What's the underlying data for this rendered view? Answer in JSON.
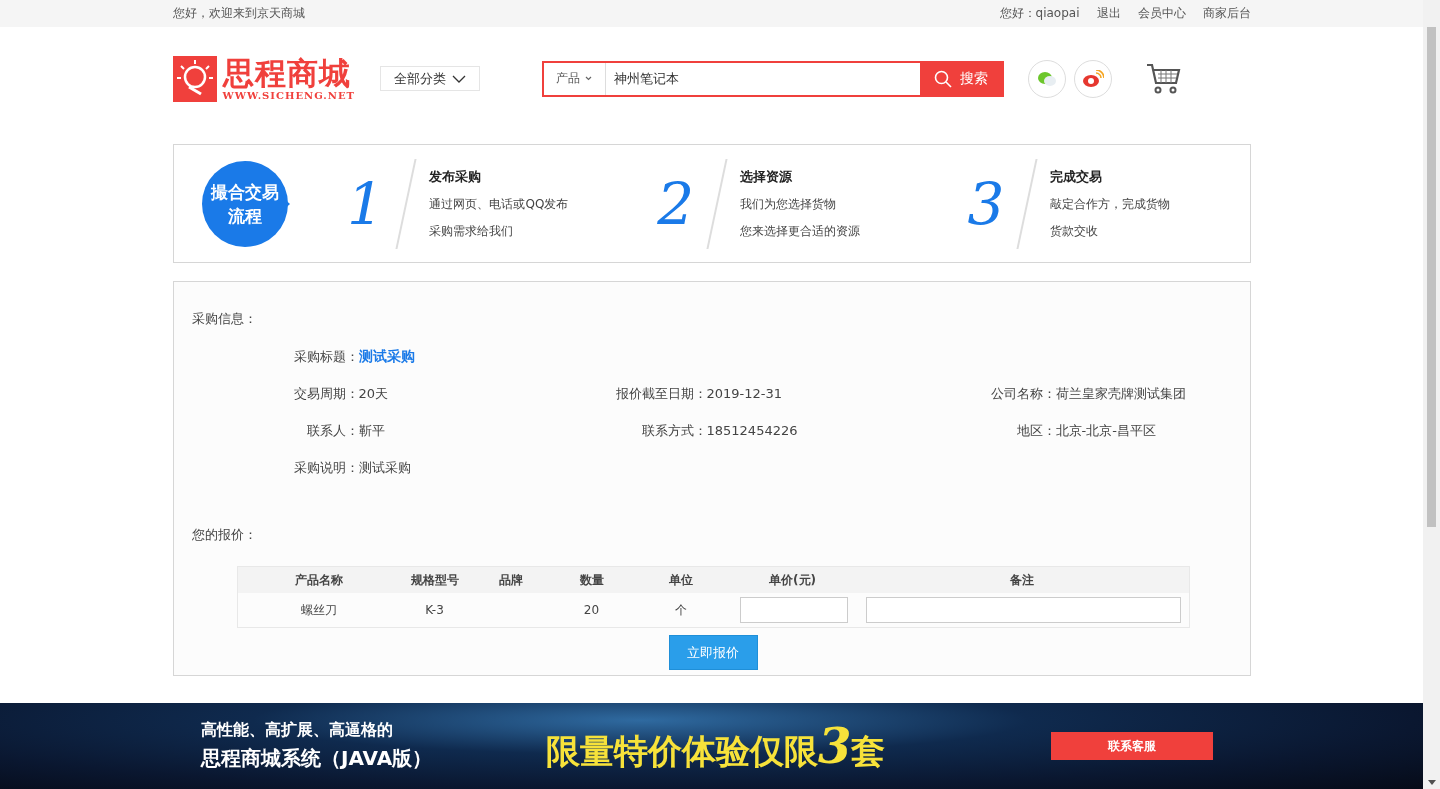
{
  "top_bar": {
    "welcome": "您好，欢迎来到京天商城",
    "user": "您好：qiaopai",
    "links": [
      "退出",
      "会员中心",
      "商家后台"
    ]
  },
  "header": {
    "logo": {
      "name": "思程商城",
      "url": "WWW.SICHENG.NET"
    },
    "category_button": "全部分类",
    "search": {
      "scope": "产品",
      "value": "神州笔记本",
      "button": "搜索"
    }
  },
  "process": {
    "badge": [
      "撮合交易",
      "流程"
    ],
    "steps": [
      {
        "number": "1",
        "title": "发布采购",
        "lines": [
          "通过网页、电话或QQ发布",
          "采购需求给我们"
        ]
      },
      {
        "number": "2",
        "title": "选择资源",
        "lines": [
          "我们为您选择货物",
          "您来选择更合适的资源"
        ]
      },
      {
        "number": "3",
        "title": "完成交易",
        "lines": [
          "敲定合作方，完成货物",
          "货款交收"
        ]
      }
    ]
  },
  "purchase": {
    "heading": "采购信息：",
    "rows": [
      [
        {
          "label": "采购标题：",
          "value": "测试采购",
          "kind": "link"
        }
      ],
      [
        {
          "label": "交易周期：",
          "value": "20天",
          "kind": "text"
        },
        {
          "label": "报价截至日期：",
          "value": "2019-12-31",
          "kind": "text"
        },
        {
          "label": "公司名称：",
          "value": "荷兰皇家壳牌测试集团",
          "kind": "text"
        }
      ],
      [
        {
          "label": "联系人：",
          "value": "靳平",
          "kind": "text"
        },
        {
          "label": "联系方式：",
          "value": "18512454226",
          "kind": "text"
        },
        {
          "label": "地区：",
          "value": "北京-北京-昌平区",
          "kind": "text"
        }
      ],
      [
        {
          "label": "采购说明：",
          "value": "测试采购",
          "kind": "text"
        }
      ]
    ],
    "quote_heading": "您的报价：",
    "table": {
      "columns": [
        "产品名称",
        "规格型号",
        "品牌",
        "数量",
        "单位",
        "单价(元)",
        "备注"
      ],
      "rows": [
        {
          "product": "螺丝刀",
          "model": "K-3",
          "quantity": "20",
          "unit": "个"
        }
      ]
    },
    "submit": "立即报价"
  },
  "banner": {
    "lines": [
      "高性能、高扩展、高逼格的",
      "思程商城系统（JAVA版）"
    ],
    "promo": [
      {
        "kind": "text",
        "text": "限量特价体验仅限"
      },
      {
        "kind": "number",
        "text": "3"
      },
      {
        "kind": "text",
        "text": "套"
      }
    ],
    "button": "联系客服"
  }
}
